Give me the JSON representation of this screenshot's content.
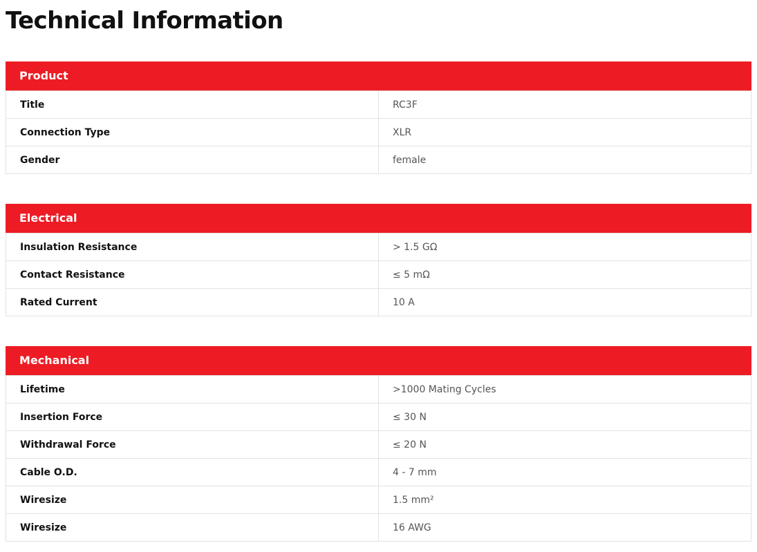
{
  "page_title": "Technical Information",
  "accent_color": "#ed1c24",
  "sections": [
    {
      "title": "Product",
      "rows": [
        {
          "label": "Title",
          "value": "RC3F"
        },
        {
          "label": "Connection Type",
          "value": "XLR"
        },
        {
          "label": "Gender",
          "value": "female"
        }
      ]
    },
    {
      "title": "Electrical",
      "rows": [
        {
          "label": "Insulation Resistance",
          "value": "> 1.5 GΩ"
        },
        {
          "label": "Contact Resistance",
          "value": "≤ 5 mΩ"
        },
        {
          "label": "Rated Current",
          "value": "10 A"
        }
      ]
    },
    {
      "title": "Mechanical",
      "rows": [
        {
          "label": "Lifetime",
          "value": ">1000 Mating Cycles"
        },
        {
          "label": "Insertion Force",
          "value": "≤ 30 N"
        },
        {
          "label": "Withdrawal Force",
          "value": "≤ 20 N"
        },
        {
          "label": "Cable O.D.",
          "value": "4 - 7 mm"
        },
        {
          "label": "Wiresize",
          "value": "1.5 mm²"
        },
        {
          "label": "Wiresize",
          "value": "16 AWG"
        }
      ]
    }
  ]
}
